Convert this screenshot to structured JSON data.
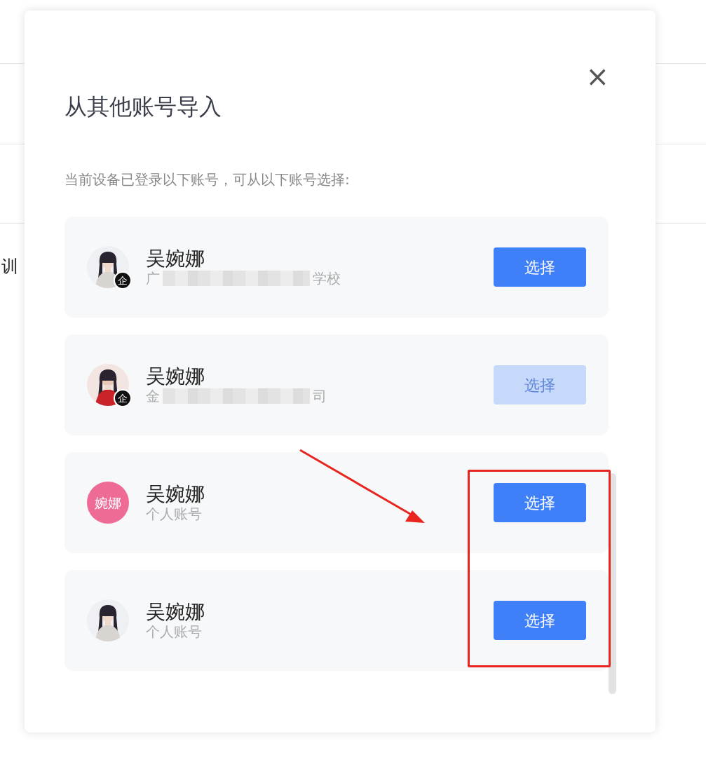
{
  "background": {
    "text": "训"
  },
  "dialog": {
    "title": "从其他账号导入",
    "close": "×",
    "prompt": "当前设备已登录以下账号，可从以下账号选择:",
    "accounts": [
      {
        "avatar": {
          "kind": "picture",
          "badge": "企"
        },
        "name": "吴婉娜",
        "subtitle": [
          {
            "kind": "text",
            "text": "广"
          },
          {
            "kind": "mosaic"
          },
          {
            "kind": "text",
            "text": "学校"
          }
        ],
        "button": "选择",
        "disabled": false
      },
      {
        "avatar": {
          "kind": "picture",
          "badge": "企"
        },
        "name": "吴婉娜",
        "subtitle": [
          {
            "kind": "text",
            "text": "金"
          },
          {
            "kind": "mosaic"
          },
          {
            "kind": "text",
            "text": "司"
          }
        ],
        "button": "选择",
        "disabled": true
      },
      {
        "avatar": {
          "kind": "initials",
          "initials": "婉娜",
          "color": "#ee6b96"
        },
        "name": "吴婉娜",
        "subtitle": [
          {
            "kind": "text",
            "text": "个人账号"
          }
        ],
        "button": "选择",
        "disabled": false
      },
      {
        "name": "吴婉娜",
        "subtitle": [
          {
            "kind": "text",
            "text": "个人账号"
          }
        ],
        "button": "选择",
        "disabled": false
      }
    ]
  },
  "annotation": {
    "highlight_box": true,
    "arrow": true
  }
}
